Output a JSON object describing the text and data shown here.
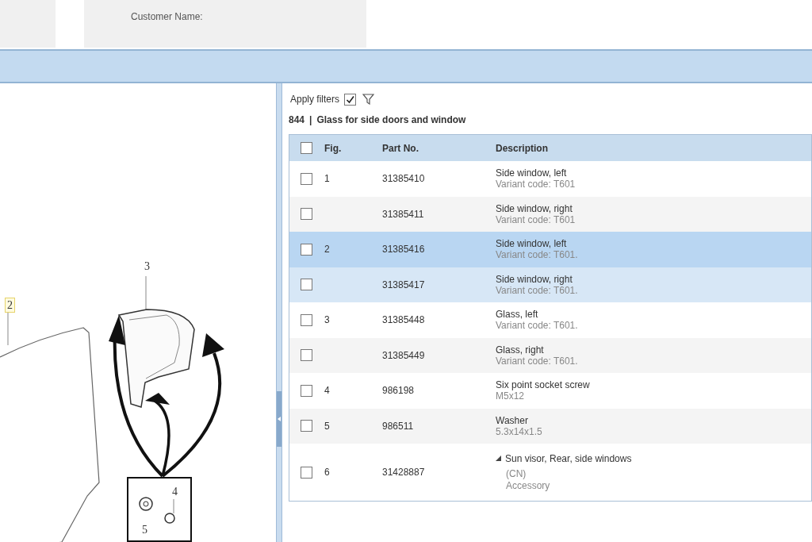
{
  "header": {
    "customer_label": "Customer Name:"
  },
  "diagram": {
    "callouts": [
      {
        "label": "2",
        "highlighted": true
      },
      {
        "label": "3",
        "highlighted": false
      },
      {
        "label": "4",
        "highlighted": false
      },
      {
        "label": "5",
        "highlighted": false
      }
    ]
  },
  "filters": {
    "label": "Apply filters",
    "checked": true
  },
  "group": {
    "code": "844",
    "separator": "|",
    "title": "Glass for side doors and window"
  },
  "table": {
    "columns": [
      "Fig.",
      "Part No.",
      "Description"
    ],
    "header_checked": false,
    "rows": [
      {
        "fig": "1",
        "part_no": "31385410",
        "description": "Side window, left",
        "details": [
          "Variant code: T601"
        ],
        "selected": false,
        "highlighted": false,
        "checked": false,
        "expandable": false
      },
      {
        "fig": "",
        "part_no": "31385411",
        "description": "Side window, right",
        "details": [
          "Variant code: T601"
        ],
        "selected": false,
        "highlighted": false,
        "checked": false,
        "expandable": false
      },
      {
        "fig": "2",
        "part_no": "31385416",
        "description": "Side window, left",
        "details": [
          "Variant code: T601."
        ],
        "selected": true,
        "highlighted": false,
        "checked": false,
        "expandable": false
      },
      {
        "fig": "",
        "part_no": "31385417",
        "description": "Side window, right",
        "details": [
          "Variant code: T601."
        ],
        "selected": false,
        "highlighted": true,
        "checked": false,
        "expandable": false
      },
      {
        "fig": "3",
        "part_no": "31385448",
        "description": "Glass, left",
        "details": [
          "Variant code: T601."
        ],
        "selected": false,
        "highlighted": false,
        "checked": false,
        "expandable": false
      },
      {
        "fig": "",
        "part_no": "31385449",
        "description": "Glass, right",
        "details": [
          "Variant code: T601."
        ],
        "selected": false,
        "highlighted": false,
        "checked": false,
        "expandable": false
      },
      {
        "fig": "4",
        "part_no": "986198",
        "description": "Six point socket screw",
        "details": [
          "M5x12"
        ],
        "selected": false,
        "highlighted": false,
        "checked": false,
        "expandable": false
      },
      {
        "fig": "5",
        "part_no": "986511",
        "description": "Washer",
        "details": [
          "5.3x14x1.5"
        ],
        "selected": false,
        "highlighted": false,
        "checked": false,
        "expandable": false
      },
      {
        "fig": "6",
        "part_no": "31428887",
        "description": "Sun visor, Rear, side windows",
        "details": [
          "(CN)",
          "Accessory"
        ],
        "selected": false,
        "highlighted": false,
        "checked": false,
        "expandable": true
      }
    ]
  }
}
